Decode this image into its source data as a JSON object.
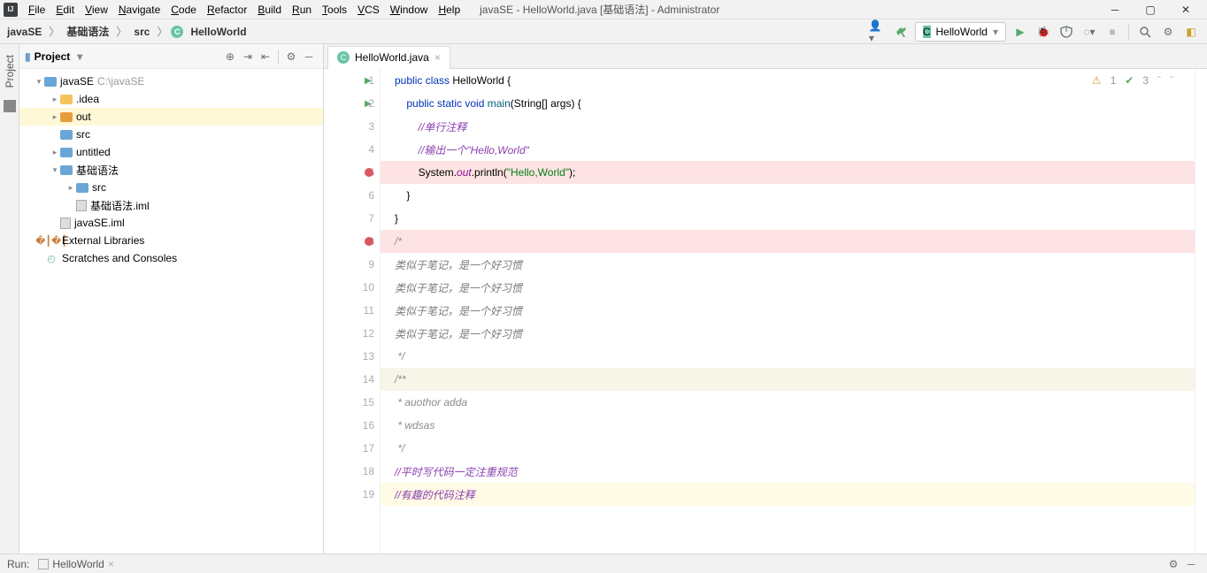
{
  "menu": {
    "items": [
      "File",
      "Edit",
      "View",
      "Navigate",
      "Code",
      "Refactor",
      "Build",
      "Run",
      "Tools",
      "VCS",
      "Window",
      "Help"
    ]
  },
  "window_title": "javaSE - HelloWorld.java [基础语法] - Administrator",
  "breadcrumb": [
    "javaSE",
    "基础语法",
    "src",
    "HelloWorld"
  ],
  "run_config": "HelloWorld",
  "project_panel": {
    "title": "Project",
    "tree": [
      {
        "depth": 0,
        "arrow": "v",
        "icon": "folder-blue",
        "label": "javaSE",
        "hint": "C:\\javaSE"
      },
      {
        "depth": 1,
        "arrow": ">",
        "icon": "folder",
        "label": ".idea"
      },
      {
        "depth": 1,
        "arrow": ">",
        "icon": "folder-orange",
        "label": "out",
        "selected": true
      },
      {
        "depth": 1,
        "arrow": "",
        "icon": "folder-blue",
        "label": "src"
      },
      {
        "depth": 1,
        "arrow": ">",
        "icon": "folder-blue",
        "label": "untitled"
      },
      {
        "depth": 1,
        "arrow": "v",
        "icon": "folder-blue",
        "label": "基础语法"
      },
      {
        "depth": 2,
        "arrow": ">",
        "icon": "folder-blue",
        "label": "src"
      },
      {
        "depth": 2,
        "arrow": "",
        "icon": "iml",
        "label": "基础语法.iml"
      },
      {
        "depth": 1,
        "arrow": "",
        "icon": "iml",
        "label": "javaSE.iml"
      },
      {
        "depth": 0,
        "arrow": ">",
        "icon": "lib",
        "label": "External Libraries"
      },
      {
        "depth": 0,
        "arrow": "",
        "icon": "scratch",
        "label": "Scratches and Consoles"
      }
    ]
  },
  "editor_tab": "HelloWorld.java",
  "inspections": {
    "warnings": "1",
    "checks": "3"
  },
  "code": {
    "lines": [
      {
        "n": 1,
        "run": true,
        "html": "<span class='kw'>public class</span> HelloWorld {"
      },
      {
        "n": 2,
        "run": true,
        "html": "    <span class='kw'>public static void</span> <span class='fn'>main</span>(String[] args) {"
      },
      {
        "n": 3,
        "html": "        <span class='cmt-slash'>//单行注释</span>"
      },
      {
        "n": 4,
        "html": "        <span class='cmt-slash'>//输出一个\"Hello,World\"</span>"
      },
      {
        "n": 5,
        "bp": true,
        "hl": "bp",
        "html": "        System.<span class='field'>out</span>.println(<span class='str'>\"Hello,World\"</span>);"
      },
      {
        "n": 6,
        "html": "    }"
      },
      {
        "n": 7,
        "html": "}"
      },
      {
        "n": 8,
        "bp": true,
        "hl": "bp",
        "html": "<span class='cmt-line'>/*</span>"
      },
      {
        "n": 9,
        "html": "<span class='cmt-zh'>类似于笔记，是一个好习惯</span>"
      },
      {
        "n": 10,
        "html": "<span class='cmt-zh'>类似于笔记，是一个好习惯</span>"
      },
      {
        "n": 11,
        "html": "<span class='cmt-zh'>类似于笔记，是一个好习惯</span>"
      },
      {
        "n": 12,
        "html": "<span class='cmt-zh'>类似于笔记，是一个好习惯</span>"
      },
      {
        "n": 13,
        "html": "<span class='cmt-line'> */</span>"
      },
      {
        "n": 14,
        "hl": "javadoc",
        "html": "<span class='javadoc'>/**</span>"
      },
      {
        "n": 15,
        "html": "<span class='cmt-line'> * auothor adda</span>"
      },
      {
        "n": 16,
        "html": "<span class='cmt-line'> * wdsas</span>"
      },
      {
        "n": 17,
        "html": "<span class='cmt-line'> */</span>"
      },
      {
        "n": 18,
        "html": "<span class='cmt-slash'>//平时写代码一定注重规范</span>"
      },
      {
        "n": 19,
        "hl": "cursor",
        "html": "<span class='cmt-slash'>//有趣的代码注释</span>"
      }
    ]
  },
  "runbar": {
    "label": "Run:",
    "target": "HelloWorld"
  },
  "sidebar_label": "Project"
}
